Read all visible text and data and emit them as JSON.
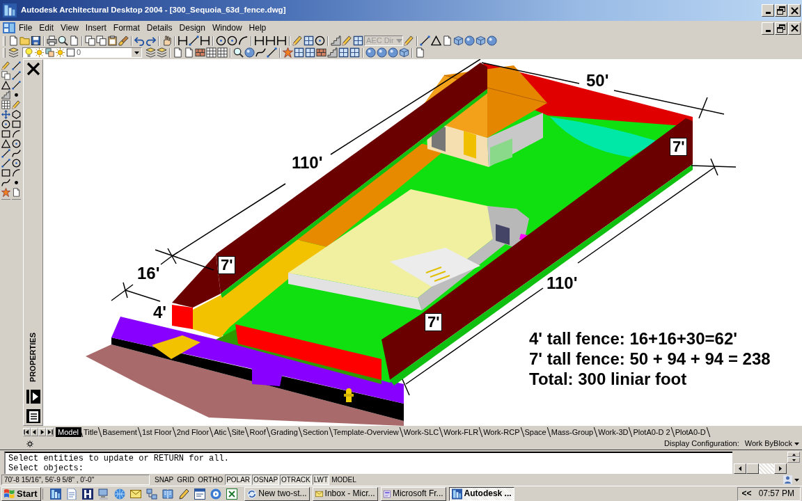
{
  "window": {
    "title": "Autodesk Architectural Desktop 2004 - [300_Sequoia_63d_fence.dwg]"
  },
  "menu": [
    "File",
    "Edit",
    "View",
    "Insert",
    "Format",
    "Details",
    "Design",
    "Window",
    "Help"
  ],
  "toolbars": {
    "aec_dropdown": {
      "value": "AEC Dir",
      "disabled": true
    },
    "layer_dropdown": {
      "value": "0"
    }
  },
  "properties_palette": {
    "title": "PROPERTIES"
  },
  "drawing": {
    "dimension_labels": [
      {
        "text": "50'",
        "kind": "plain"
      },
      {
        "text": "7'",
        "kind": "boxed"
      },
      {
        "text": "110'",
        "kind": "plain"
      },
      {
        "text": "7'",
        "kind": "boxed"
      },
      {
        "text": "16'",
        "kind": "plain"
      },
      {
        "text": "110'",
        "kind": "plain"
      },
      {
        "text": "4'",
        "kind": "plain"
      },
      {
        "text": "7'",
        "kind": "boxed"
      }
    ],
    "notes": [
      "4' tall fence: 16+16+30=62'",
      "7' tall fence: 50 + 94 + 94 = 238",
      "Total: 300 liniar foot"
    ]
  },
  "layout_tabs": [
    {
      "label": "Model",
      "selected": true
    },
    {
      "label": "Title",
      "selected": false
    },
    {
      "label": "Basement",
      "selected": false
    },
    {
      "label": "1st Floor",
      "selected": false
    },
    {
      "label": "2nd Floor",
      "selected": false
    },
    {
      "label": "Atic",
      "selected": false
    },
    {
      "label": "Site",
      "selected": false
    },
    {
      "label": "Roof",
      "selected": false
    },
    {
      "label": "Grading",
      "selected": false
    },
    {
      "label": "Section",
      "selected": false
    },
    {
      "label": "Template-Overview",
      "selected": false
    },
    {
      "label": "Work-SLC",
      "selected": false
    },
    {
      "label": "Work-FLR",
      "selected": false
    },
    {
      "label": "Work-RCP",
      "selected": false
    },
    {
      "label": "Space",
      "selected": false
    },
    {
      "label": "Mass-Group",
      "selected": false
    },
    {
      "label": "Work-3D",
      "selected": false
    },
    {
      "label": "PlotA0-D 2",
      "selected": false
    },
    {
      "label": "PlotA0-D",
      "selected": false
    }
  ],
  "display_configuration": {
    "label": "Display Configuration:",
    "value": "Work ByBlock"
  },
  "command_lines": [
    "Select entities to update or RETURN for all.",
    "Select objects:"
  ],
  "status_bar": {
    "coordinates": "70'-8 15/16\", 56'-9 5/8\" , 0'-0\"",
    "toggles": [
      {
        "label": "SNAP",
        "on": false
      },
      {
        "label": "GRID",
        "on": false
      },
      {
        "label": "ORTHO",
        "on": false
      },
      {
        "label": "POLAR",
        "on": true
      },
      {
        "label": "OSNAP",
        "on": true
      },
      {
        "label": "OTRACK",
        "on": true
      },
      {
        "label": "LWT",
        "on": true
      },
      {
        "label": "MODEL",
        "on": false
      }
    ]
  },
  "taskbar": {
    "start": "Start",
    "tasks": [
      {
        "label": "New two-st...",
        "selected": false
      },
      {
        "label": "Inbox - Micr...",
        "selected": false
      },
      {
        "label": "Microsoft Fr...",
        "selected": false
      },
      {
        "label": "Autodesk ...",
        "selected": true
      }
    ],
    "tray_toggle": "<<",
    "clock": "07:57 PM"
  }
}
